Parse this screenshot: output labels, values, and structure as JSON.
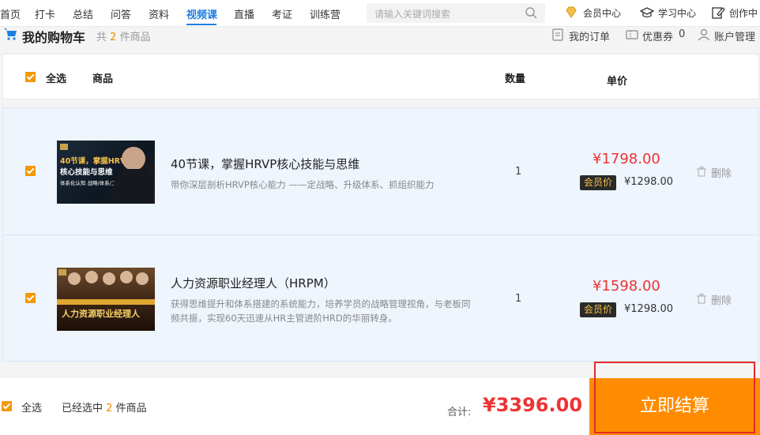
{
  "nav": {
    "items": [
      "首页",
      "打卡",
      "总结",
      "问答",
      "资料",
      "视频课",
      "直播",
      "考证",
      "训练营"
    ],
    "active": "视频课",
    "search_placeholder": "请输入关键词搜索",
    "utilities": [
      "会员中心",
      "学习中心",
      "创作中"
    ]
  },
  "cart": {
    "title": "我的购物车",
    "count_prefix": "共",
    "count": "2",
    "count_suffix": "件商品",
    "links": {
      "orders": "我的订单",
      "coupons": "优惠券",
      "coupon_count": "0",
      "account": "账户管理"
    }
  },
  "table_header": {
    "select_all": "全选",
    "product": "商品",
    "quantity": "数量",
    "unit_price": "单价"
  },
  "items": [
    {
      "thumb_line1": "40节课，掌握HRVP",
      "thumb_line2": "核心技能与思维",
      "thumb_tag": "体系化认知 战略/体系/工具",
      "title": "40节课，掌握HRVP核心技能与思维",
      "desc": "带你深层剖析HRVP核心能力 ——定战略、升级体系、抓组织能力",
      "quantity": "1",
      "price": "¥1798.00",
      "vip_label": "会员价",
      "vip_price": "¥1298.00",
      "delete_label": "删除"
    },
    {
      "thumb_line1": "人力资源职业经理人",
      "title": "人力资源职业经理人（HRPM）",
      "desc": "获得思维提升和体系搭建的系统能力，培养学员的战略管理视角，与老板同频共振，实现60天迅速从HR主管进阶HRD的华丽转身。",
      "quantity": "1",
      "price": "¥1598.00",
      "vip_label": "会员价",
      "vip_price": "¥1298.00",
      "delete_label": "删除"
    }
  ],
  "footer": {
    "select_all": "全选",
    "selected_prefix": "已经选中",
    "selected_count": "2",
    "selected_suffix": "件商品",
    "total_label": "合计:",
    "total": "¥3396.00",
    "checkout": "立即结算"
  },
  "colors": {
    "accent": "#1e7fe0",
    "orange": "#ff8c00",
    "price_red": "#e33333"
  }
}
